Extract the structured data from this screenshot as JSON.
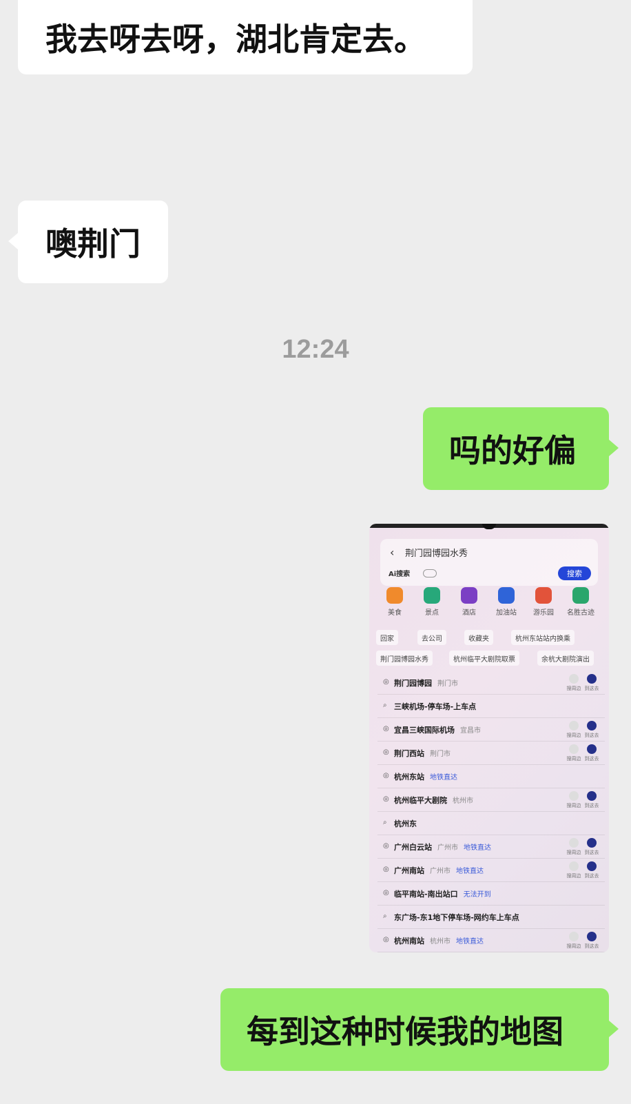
{
  "messages": {
    "m1": "我去呀去呀，湖北肯定去。",
    "m2": "噢荆门",
    "time": "12:24",
    "m3": "吗的好偏",
    "m4": "每到这种时候我的地图"
  },
  "screenshot": {
    "query": "荆门园博园水秀",
    "ai_label": "Ai搜索",
    "search_btn": "搜索",
    "categories": [
      "美食",
      "景点",
      "酒店",
      "加油站",
      "游乐园",
      "名胜古迹"
    ],
    "chips_row1": [
      "回家",
      "去公司",
      "收藏夹",
      "杭州东站站内换乘"
    ],
    "chips_row2": [
      "荆门园博园水秀",
      "杭州临平大剧院取票",
      "余杭大剧院演出"
    ],
    "actions": {
      "nearby": "搜周边",
      "go": "到这去"
    },
    "results": [
      {
        "name": "荆门园博园",
        "sub": "荆门市",
        "tag": "",
        "acts": true
      },
      {
        "name": "三峡机场-停车场-上车点",
        "sub": "",
        "tag": "",
        "acts": false
      },
      {
        "name": "宜昌三峡国际机场",
        "sub": "宜昌市",
        "tag": "",
        "acts": true
      },
      {
        "name": "荆门西站",
        "sub": "荆门市",
        "tag": "",
        "acts": true
      },
      {
        "name": "杭州东站",
        "sub": "",
        "tag": "地铁直达",
        "acts": false
      },
      {
        "name": "杭州临平大剧院",
        "sub": "杭州市",
        "tag": "",
        "acts": true
      },
      {
        "name": "杭州东",
        "sub": "",
        "tag": "",
        "acts": false
      },
      {
        "name": "广州白云站",
        "sub": "广州市",
        "tag": "地铁直达",
        "acts": true
      },
      {
        "name": "广州南站",
        "sub": "广州市",
        "tag": "地铁直达",
        "acts": true
      },
      {
        "name": "临平南站-南出站口",
        "sub": "",
        "tag": "无法开到",
        "acts": false
      },
      {
        "name": "东广场-东1地下停车场-网约车上车点",
        "sub": "",
        "tag": "",
        "acts": false
      },
      {
        "name": "杭州南站",
        "sub": "杭州市",
        "tag": "地铁直达",
        "acts": true
      }
    ]
  }
}
